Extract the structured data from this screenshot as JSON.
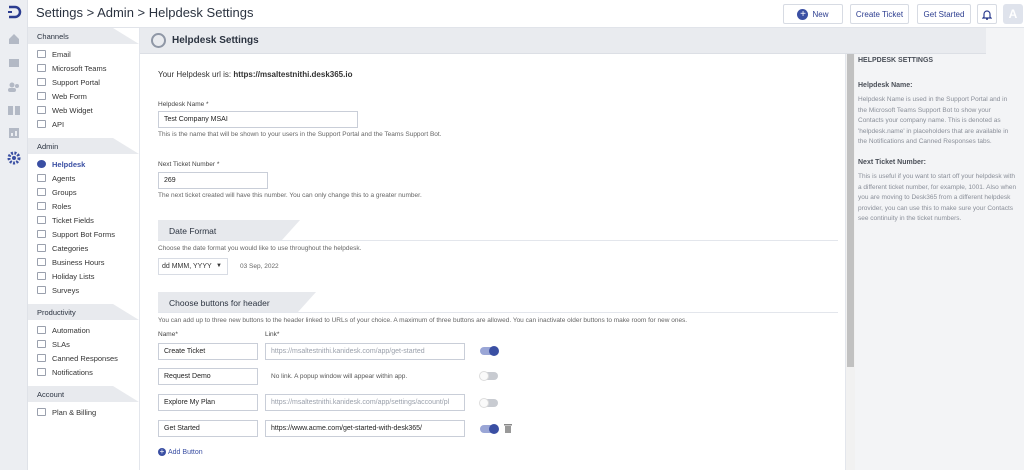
{
  "topbar": {
    "breadcrumb": "Settings > Admin > Helpdesk Settings",
    "new_label": "New",
    "create_ticket_label": "Create Ticket",
    "get_started_label": "Get Started",
    "avatar_letter": "A"
  },
  "sidebar": {
    "channels_title": "Channels",
    "channels": [
      "Email",
      "Microsoft Teams",
      "Support Portal",
      "Web Form",
      "Web Widget",
      "API"
    ],
    "admin_title": "Admin",
    "admin": [
      "Helpdesk",
      "Agents",
      "Groups",
      "Roles",
      "Ticket Fields",
      "Support Bot Forms",
      "Categories",
      "Business Hours",
      "Holiday Lists",
      "Surveys"
    ],
    "productivity_title": "Productivity",
    "productivity": [
      "Automation",
      "SLAs",
      "Canned Responses",
      "Notifications"
    ],
    "account_title": "Account",
    "account": [
      "Plan & Billing"
    ]
  },
  "page": {
    "title": "Helpdesk Settings",
    "url_prefix": "Your Helpdesk url is:",
    "url_value": "https://msaltestnithi.desk365.io",
    "name_label": "Helpdesk Name *",
    "name_value": "Test Company MSAI",
    "name_hint": "This is the name that will be shown to your users in the Support Portal and the Teams Support Bot.",
    "next_label": "Next Ticket Number *",
    "next_value": "269",
    "next_hint": "The next ticket created will have this number. You can only change this to a greater number.",
    "date_section": "Date Format",
    "date_hint": "Choose the date format you would like to use throughout the helpdesk.",
    "date_format": "dd MMM, YYYY",
    "date_preview": "03 Sep, 2022",
    "buttons_section": "Choose buttons for header",
    "buttons_hint": "You can add up to three new buttons to the header linked to URLs of your choice. A maximum of three buttons are allowed. You can inactivate older buttons to make room for new ones.",
    "col_name": "Name*",
    "col_link": "Link*",
    "rows": [
      {
        "name": "Create Ticket",
        "link": "https://msaltestnithi.kanidesk.com/app/get-started",
        "link_muted": true,
        "enabled": true
      },
      {
        "name": "Request Demo",
        "link": "No link. A popup window will appear within app.",
        "link_muted": false,
        "enabled": false
      },
      {
        "name": "Explore My Plan",
        "link": "https://msaltestnithi.kanidesk.com/app/settings/account/pl",
        "link_muted": true,
        "enabled": false
      },
      {
        "name": "Get Started",
        "link": "https://www.acme.com/get-started-with-desk365/",
        "link_muted": false,
        "enabled": true
      }
    ],
    "add_button": "Add Button"
  },
  "help": {
    "heading": "HELPDESK SETTINGS",
    "s1_title": "Helpdesk Name:",
    "s1_text": "Helpdesk Name is used in the Support Portal and in the Microsoft Teams Support Bot to show your Contacts your company name. This is denoted as 'helpdesk.name' in placeholders that are available in the Notifications and Canned Responses tabs.",
    "s2_title": "Next Ticket Number:",
    "s2_text": "This is useful if you want to start off your helpdesk with a different ticket number, for example, 1001. Also when you are moving to Desk365 from a different helpdesk provider, you can use this to make sure your Contacts see continuity in the ticket numbers."
  },
  "colors": {
    "accent": "#3a4fa3",
    "rail": "#eceef2",
    "band": "#e7e9ed"
  }
}
